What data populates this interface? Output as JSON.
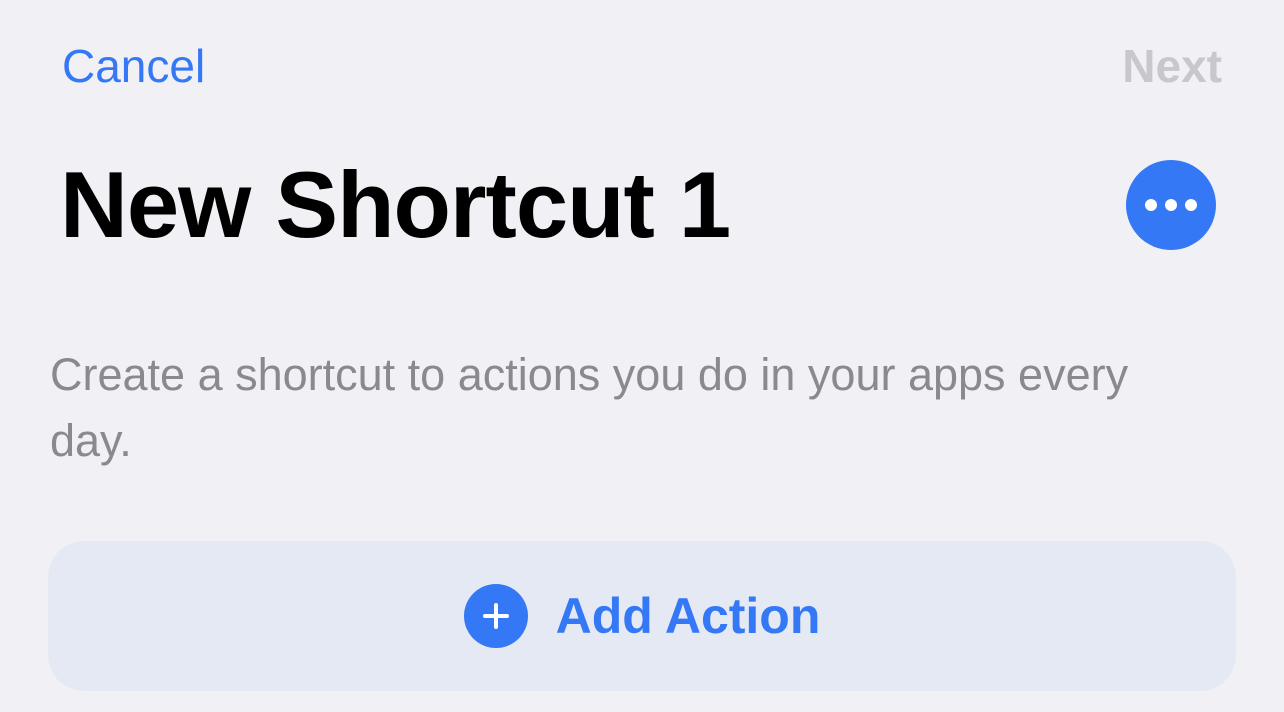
{
  "nav": {
    "cancel_label": "Cancel",
    "next_label": "Next"
  },
  "header": {
    "title": "New Shortcut 1",
    "more_icon": "ellipsis-icon"
  },
  "main": {
    "description": "Create a shortcut to actions you do in your apps every day.",
    "add_action_label": "Add Action",
    "add_action_icon": "plus-circle-icon"
  },
  "colors": {
    "accent": "#3478f6",
    "background": "#f0f0f5",
    "disabled": "#c7c7cc",
    "secondary_text": "#8a8a8e",
    "button_background": "#e4e9f4"
  }
}
